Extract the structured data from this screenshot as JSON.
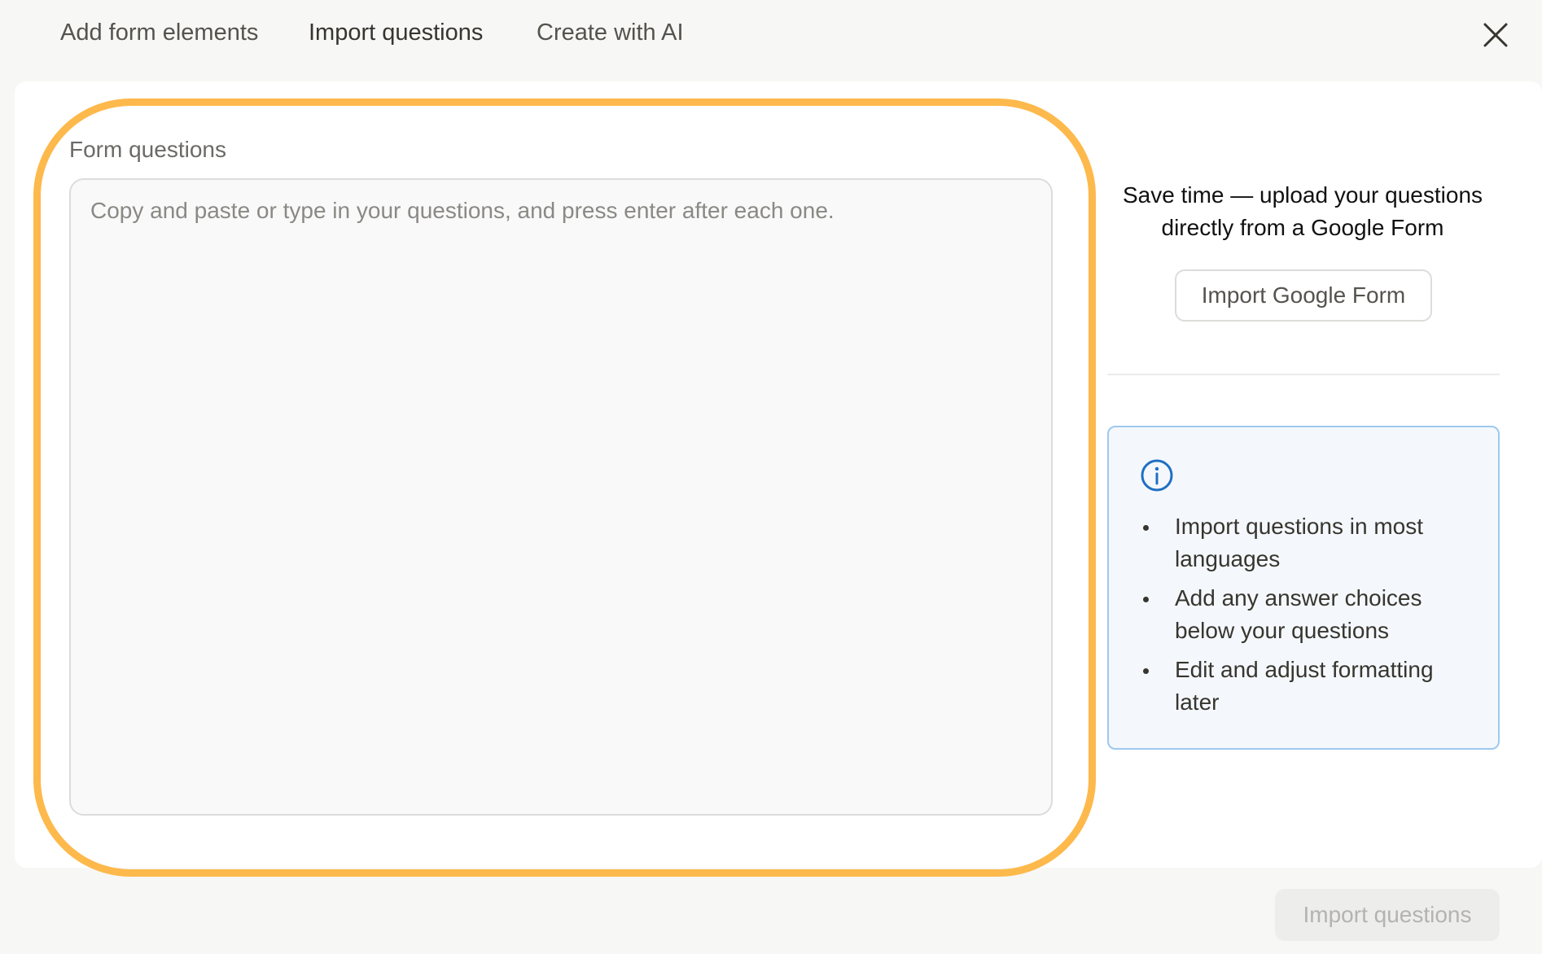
{
  "tabs": [
    {
      "label": "Add form elements"
    },
    {
      "label": "Import questions"
    },
    {
      "label": "Create with AI"
    }
  ],
  "close_icon": "close-icon",
  "form": {
    "label": "Form questions",
    "placeholder": "Copy and paste or type in your questions, and press enter after each one.",
    "value": ""
  },
  "side": {
    "text": "Save time — upload your questions directly from a Google Form",
    "button_label": "Import Google Form"
  },
  "info": {
    "icon": "info-icon",
    "items": [
      "Import questions in most languages",
      "Add any answer choices below your questions",
      "Edit and adjust formatting later"
    ]
  },
  "footer": {
    "submit_label": "Import questions"
  },
  "colors": {
    "highlight": "#fdb94b",
    "info_accent": "#1f6fc2",
    "info_border": "#9ec9ef",
    "info_bg": "#f4f8fc"
  }
}
